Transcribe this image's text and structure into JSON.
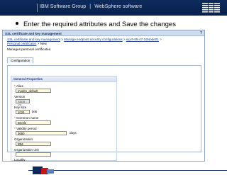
{
  "header": {
    "brand": "IBM Software Group",
    "separator": "|",
    "product": "WebSphere software",
    "logo": "IBM"
  },
  "slide": {
    "bullet": "Enter the required attributes and Save the changes"
  },
  "window": {
    "title": "SSL certificate and key management",
    "help_icon": "question-mark-icon",
    "breadcrumb": {
      "link1": "SSL certificate and key management",
      "link2": "Manage endpoint security configurations",
      "link3": "sig-9-65-47-16Node01",
      "link4": "Personal certificates",
      "current": "New",
      "separator": ">"
    },
    "description": "Manages personal certificates.",
    "tab": "Configuration",
    "section_title": "General Properties",
    "fields": {
      "alias_label": "Alias",
      "alias_value": "mode1_default",
      "version_label": "Version",
      "version_value": "X509 V3",
      "keysize_label": "Key size",
      "keysize_value": "1024",
      "keysize_unit": "bits",
      "common_name_label": "Common name",
      "common_name_value": "Beetle",
      "validity_label": "Validity period",
      "validity_value": "3650",
      "validity_unit": "days",
      "organization_label": "Organization",
      "organization_value": "IBM",
      "org_unit_label": "Organization unit",
      "locality_label": "Locality"
    }
  }
}
